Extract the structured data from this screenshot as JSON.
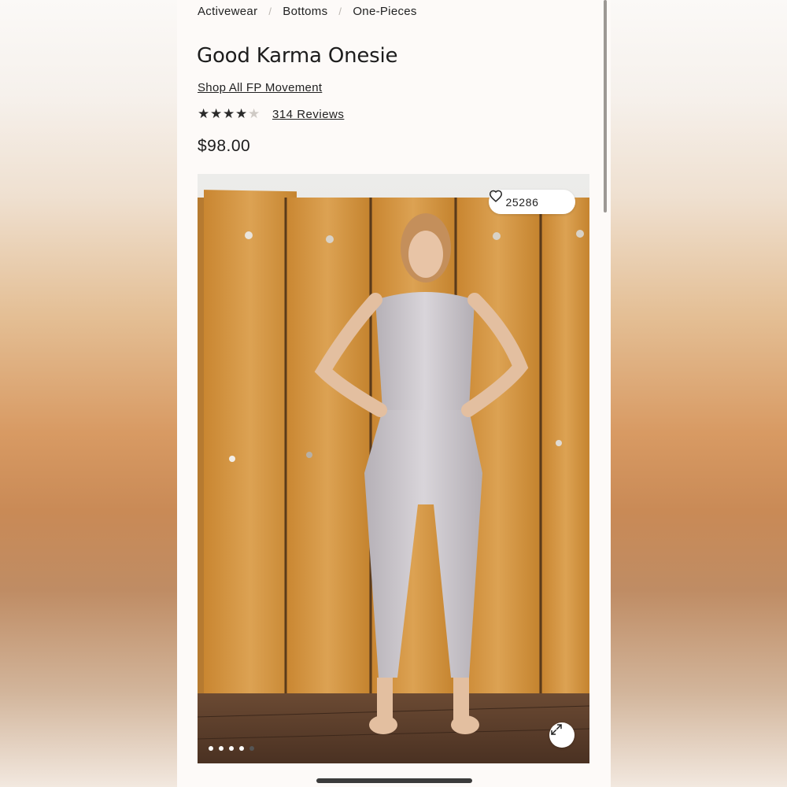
{
  "breadcrumb": [
    "Activewear",
    "Bottoms",
    "One-Pieces"
  ],
  "product": {
    "title": "Good Karma Onesie",
    "shop_link": "Shop All FP Movement",
    "rating": 4,
    "rating_max": 5,
    "reviews_label": "314 Reviews",
    "price": "$98.00",
    "likes": "25286"
  },
  "gallery": {
    "image_count": 5,
    "active_index": 4
  },
  "icons": {
    "like": "heart-icon",
    "expand": "expand-icon",
    "star": "star-icon"
  },
  "colors": {
    "text": "#222222",
    "page_bg": "#fdfaf8",
    "star_filled": "#2a2a2a",
    "star_empty": "#cfcac5"
  }
}
